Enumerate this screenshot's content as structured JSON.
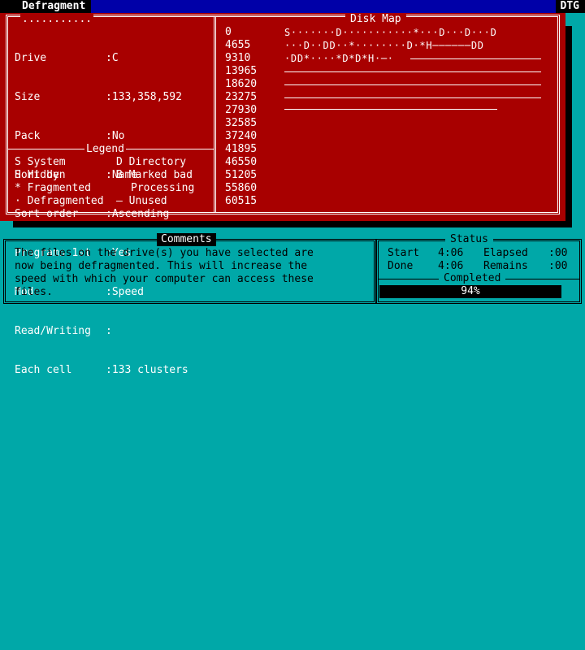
{
  "window": {
    "title": "Defragment",
    "corner_label": "DTG"
  },
  "left_panel": {
    "header_dots": "...........",
    "fields": [
      {
        "label": "Drive",
        "value": ":C"
      },
      {
        "label": "Size",
        "value": ":133,358,592"
      },
      {
        "label": "Pack",
        "value": ":No"
      },
      {
        "label": "Sort by",
        "value": ":Name"
      },
      {
        "label": "Sort order",
        "value": ":Ascending"
      },
      {
        "label": "Programs 1st",
        "value": ":Yes"
      },
      {
        "label": "Mode",
        "value": ":Speed"
      },
      {
        "label": "Read/Writing",
        "value": ":"
      },
      {
        "label": "Each cell",
        "value": ":133 clusters"
      }
    ],
    "legend_title": "Legend",
    "legend": [
      {
        "left": "S System",
        "right": "D Directory"
      },
      {
        "left": "H Hidden",
        "right": "B Marked bad"
      },
      {
        "left": "* Fragmented",
        "right": "Processing"
      },
      {
        "left": "· Defragmented",
        "right": "— Unused"
      }
    ]
  },
  "cell_numbers": [
    "0",
    "4655",
    "9310",
    "13965",
    "18620",
    "23275",
    "27930",
    "32585",
    "37240",
    "41895",
    "46550",
    "51205",
    "55860",
    "60515"
  ],
  "disk_map": {
    "title": "Disk Map",
    "rows": [
      "S·······D···········*···D···D···D",
      "···D··DD··*········D·*H──────DD",
      "·DD*····*D*D*H·─·"
    ],
    "unused_lines": 3
  },
  "comments": {
    "title": "Comments",
    "lines": [
      "The files on the drive(s) you have selected are",
      "now being defragmented. This will increase the",
      "speed with which your computer can access these",
      "files."
    ]
  },
  "status": {
    "title": "Status",
    "start_label": "Start",
    "start_value": "4:06",
    "elapsed_label": "Elapsed",
    "elapsed_value": ":00",
    "done_label": "Done",
    "done_value": "4:06",
    "remains_label": "Remains",
    "remains_value": ":00",
    "completed_title": "Completed",
    "progress_text": "94%",
    "progress_percent": 94
  },
  "colors": {
    "panel": "#a80000",
    "background": "#00a8a8",
    "titlebar": "#0000a8"
  }
}
